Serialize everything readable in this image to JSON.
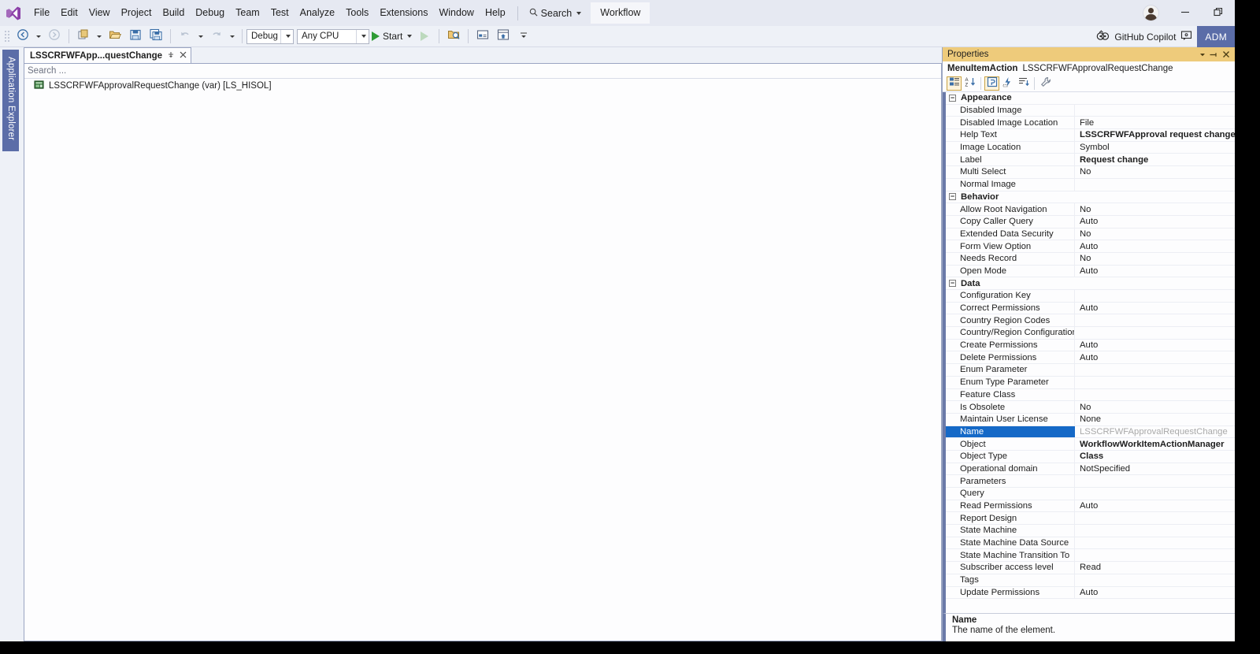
{
  "menubar": {
    "logo_icon": "visual-studio-logo",
    "items": [
      "File",
      "Edit",
      "View",
      "Project",
      "Build",
      "Debug",
      "Team",
      "Test",
      "Analyze",
      "Tools",
      "Extensions",
      "Window",
      "Help"
    ],
    "search": {
      "label": "Search",
      "icon": "magnifier-icon"
    },
    "workflow_chip": "Workflow",
    "avatar_icon": "user-avatar",
    "minimize_icon": "minimize-icon",
    "restore_icon": "restore-icon"
  },
  "toolbar": {
    "nav_back_icon": "navigate-back-icon",
    "nav_forward_icon": "navigate-forward-icon",
    "new_project_icon": "new-project-icon",
    "open_file_icon": "open-file-icon",
    "save_icon": "save-icon",
    "save_all_icon": "save-all-icon",
    "undo_icon": "undo-icon",
    "redo_icon": "redo-icon",
    "configuration": "Debug",
    "platform": "Any CPU",
    "start_label": "Start",
    "start_icon": "play-icon",
    "attach_icon": "play-outline-icon",
    "find_icon": "find-in-files-icon",
    "extra1_icon": "properties-window-icon",
    "extra2_icon": "solution-explorer-icon",
    "overflow_icon": "toolbar-overflow-icon",
    "copilot_label": "GitHub Copilot",
    "copilot_icon": "github-copilot-icon",
    "copilot_status_icon": "copilot-status-icon",
    "account_chip": "ADM"
  },
  "leftdock": {
    "application_explorer": "Application Explorer"
  },
  "editor": {
    "tab": {
      "title": "LSSCRFWFApp...questChange",
      "pin_icon": "pin-icon",
      "close_icon": "close-icon"
    },
    "search_placeholder": "Search ...",
    "tree": [
      {
        "icon": "workflow-element-icon",
        "label": "LSSCRFWFApprovalRequestChange (var) [LS_HISOL]"
      }
    ]
  },
  "properties": {
    "panel_title": "Properties",
    "title_dropdown_icon": "chevron-down-icon",
    "title_pin_icon": "pin-icon",
    "title_close_icon": "close-icon",
    "element_type": "MenuItemAction",
    "element_name": "LSSCRFWFApprovalRequestChange",
    "toolbar_buttons": [
      {
        "icon": "categorized-view-icon",
        "selected": true
      },
      {
        "icon": "alphabetical-sort-icon",
        "selected": false
      },
      {
        "icon": "properties-view-icon",
        "selected": true
      },
      {
        "icon": "events-view-icon",
        "selected": false
      },
      {
        "icon": "property-pages-icon",
        "selected": false
      },
      {
        "icon": "wrench-icon",
        "selected": false
      }
    ],
    "selected_property": "Name",
    "groups": [
      {
        "name": "Appearance",
        "rows": [
          {
            "name": "Disabled Image",
            "value": "",
            "bold": false
          },
          {
            "name": "Disabled Image Location",
            "value": "File",
            "bold": false
          },
          {
            "name": "Help Text",
            "value": "LSSCRFWFApproval request change action",
            "bold": true
          },
          {
            "name": "Image Location",
            "value": "Symbol",
            "bold": false
          },
          {
            "name": "Label",
            "value": "Request change",
            "bold": true
          },
          {
            "name": "Multi Select",
            "value": "No",
            "bold": false
          },
          {
            "name": "Normal Image",
            "value": "",
            "bold": false
          }
        ]
      },
      {
        "name": "Behavior",
        "rows": [
          {
            "name": "Allow Root Navigation",
            "value": "No",
            "bold": false
          },
          {
            "name": "Copy Caller Query",
            "value": "Auto",
            "bold": false
          },
          {
            "name": "Extended Data Security",
            "value": "No",
            "bold": false
          },
          {
            "name": "Form View Option",
            "value": "Auto",
            "bold": false
          },
          {
            "name": "Needs Record",
            "value": "No",
            "bold": false
          },
          {
            "name": "Open Mode",
            "value": "Auto",
            "bold": false
          }
        ]
      },
      {
        "name": "Data",
        "rows": [
          {
            "name": "Configuration Key",
            "value": "",
            "bold": false
          },
          {
            "name": "Correct Permissions",
            "value": "Auto",
            "bold": false
          },
          {
            "name": "Country Region Codes",
            "value": "",
            "bold": false
          },
          {
            "name": "Country/Region Configuration Ke",
            "value": "",
            "bold": false
          },
          {
            "name": "Create Permissions",
            "value": "Auto",
            "bold": false
          },
          {
            "name": "Delete Permissions",
            "value": "Auto",
            "bold": false
          },
          {
            "name": "Enum Parameter",
            "value": "",
            "bold": false
          },
          {
            "name": "Enum Type Parameter",
            "value": "",
            "bold": false
          },
          {
            "name": "Feature Class",
            "value": "",
            "bold": false
          },
          {
            "name": "Is Obsolete",
            "value": "No",
            "bold": false
          },
          {
            "name": "Maintain User License",
            "value": "None",
            "bold": false
          },
          {
            "name": "Name",
            "value": "LSSCRFWFApprovalRequestChange",
            "bold": false,
            "selected": true
          },
          {
            "name": "Object",
            "value": "WorkflowWorkItemActionManager",
            "bold": true
          },
          {
            "name": "Object Type",
            "value": "Class",
            "bold": true
          },
          {
            "name": "Operational domain",
            "value": "NotSpecified",
            "bold": false
          },
          {
            "name": "Parameters",
            "value": "",
            "bold": false
          },
          {
            "name": "Query",
            "value": "",
            "bold": false
          },
          {
            "name": "Read Permissions",
            "value": "Auto",
            "bold": false
          },
          {
            "name": "Report Design",
            "value": "",
            "bold": false
          },
          {
            "name": "State Machine",
            "value": "",
            "bold": false
          },
          {
            "name": "State Machine Data Source",
            "value": "",
            "bold": false
          },
          {
            "name": "State Machine Transition To",
            "value": "",
            "bold": false
          },
          {
            "name": "Subscriber access level",
            "value": "Read",
            "bold": false
          },
          {
            "name": "Tags",
            "value": "",
            "bold": false
          },
          {
            "name": "Update Permissions",
            "value": "Auto",
            "bold": false
          }
        ]
      }
    ],
    "description": {
      "title": "Name",
      "text": "The name of the element."
    }
  },
  "colors": {
    "menubar_bg": "#e6e9f2",
    "accent_purple": "#8b3fa8",
    "properties_header": "#eecb7b",
    "selection_blue": "#1569c7",
    "dock_blue": "#5b6da8",
    "start_green": "#2e9b35"
  }
}
